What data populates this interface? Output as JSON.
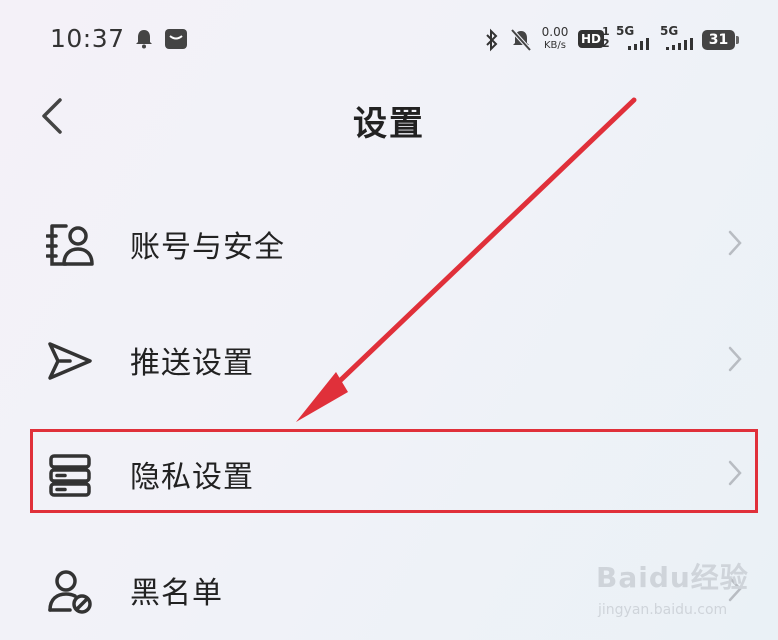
{
  "status_bar": {
    "time": "10:37",
    "net_speed_value": "0.00",
    "net_speed_unit": "KB/s",
    "hd_label": "HD",
    "sim_slot_top": "1",
    "sim_slot_bottom": "2",
    "signal1_label": "5G",
    "signal2_label": "5G",
    "battery_level": "31"
  },
  "header": {
    "back_icon": "chevron-left-icon",
    "title": "设置"
  },
  "menu": {
    "items": [
      {
        "label": "账号与安全",
        "icon": "account-security-icon"
      },
      {
        "label": "推送设置",
        "icon": "send-icon"
      },
      {
        "label": "隐私设置",
        "icon": "server-stack-icon"
      },
      {
        "label": "黑名单",
        "icon": "user-block-icon"
      }
    ]
  },
  "annotation": {
    "highlight_color": "#e0303a",
    "highlighted_item": "隐私设置"
  },
  "watermark": {
    "logo": "Baidu经验",
    "url": "jingyan.baidu.com"
  }
}
